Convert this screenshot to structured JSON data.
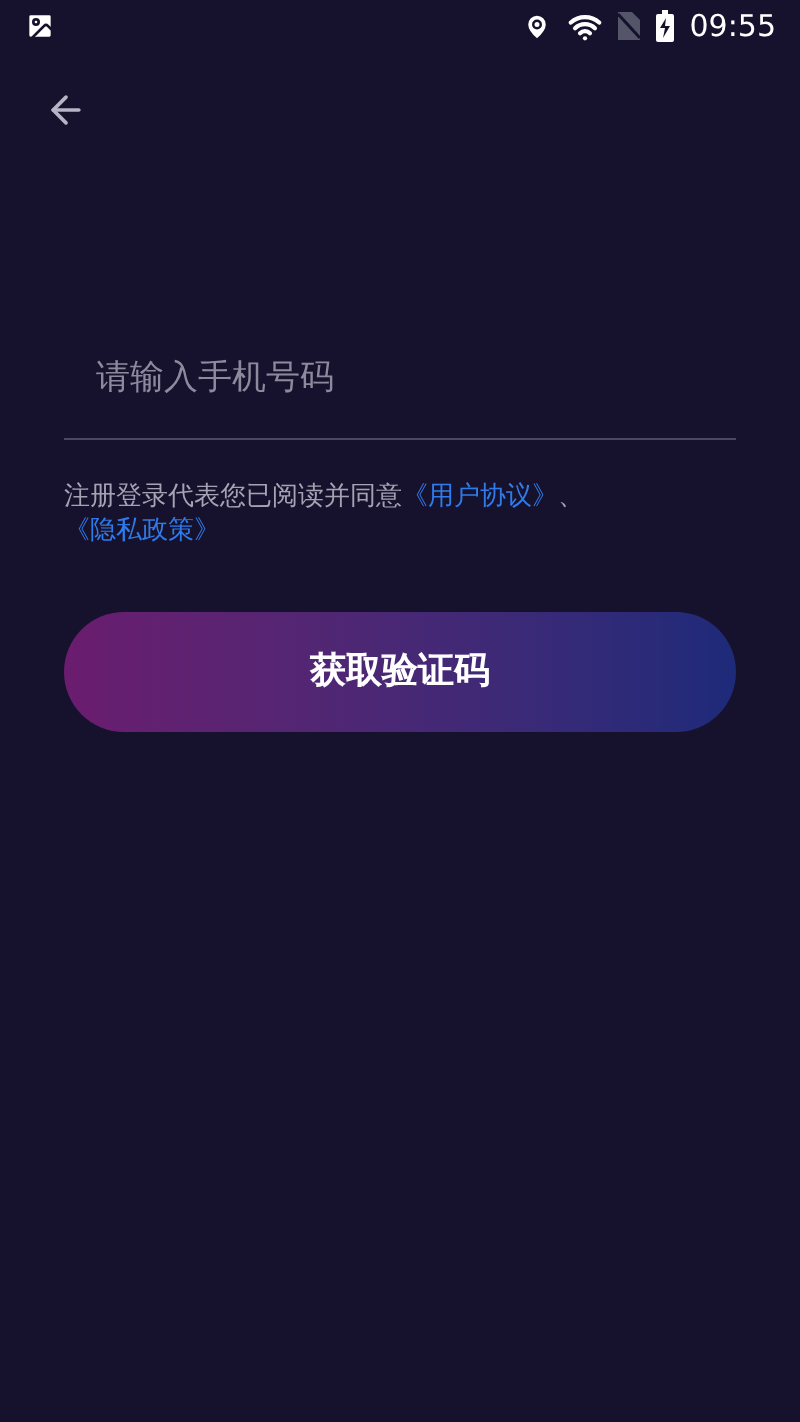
{
  "status_bar": {
    "time": "09:55"
  },
  "phone_field": {
    "placeholder": "请输入手机号码"
  },
  "agreement": {
    "text": "注册登录代表您已阅读并同意",
    "links": [
      "《用户协议》",
      "《隐私政策》"
    ],
    "separator": "、"
  },
  "submit_button": {
    "label": "获取验证码"
  }
}
